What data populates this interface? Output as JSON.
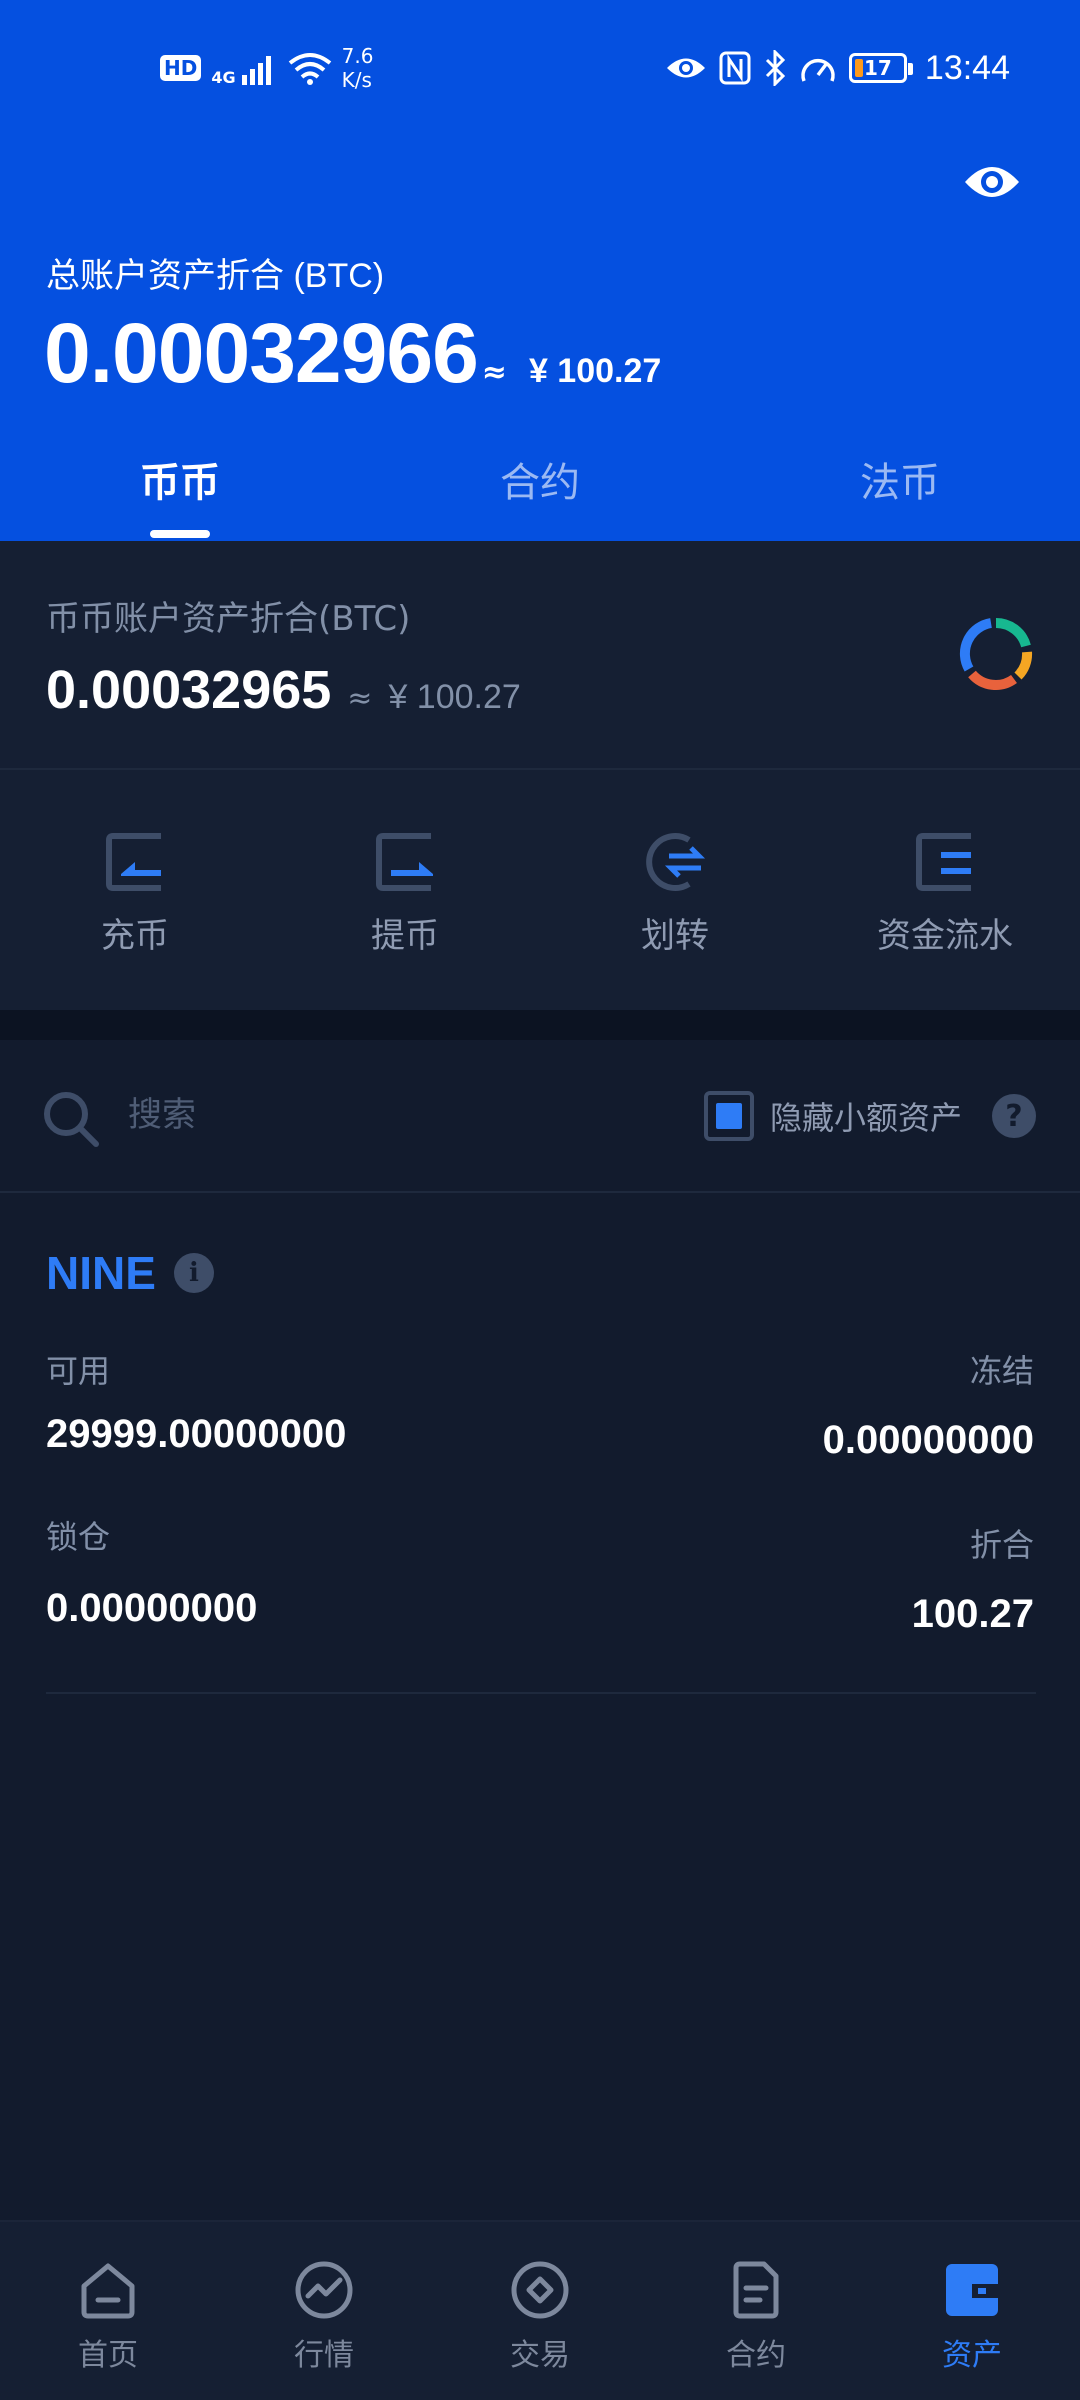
{
  "status_bar": {
    "hd": "HD",
    "network": "4G",
    "speed_value": "7.6",
    "speed_unit": "K/s",
    "battery": "17",
    "time": "13:44"
  },
  "header": {
    "total_label": "总账户资产折合 (BTC)",
    "total_value": "0.00032966",
    "approx_symbol": "≈",
    "total_cny": "¥ 100.27",
    "tabs": [
      {
        "label": "币币",
        "active": true
      },
      {
        "label": "合约",
        "active": false
      },
      {
        "label": "法币",
        "active": false
      }
    ]
  },
  "account": {
    "label": "币币账户资产折合(BTC)",
    "value": "0.00032965",
    "approx_symbol": "≈",
    "cny": "¥ 100.27"
  },
  "actions": [
    {
      "label": "充币",
      "icon": "deposit-icon"
    },
    {
      "label": "提币",
      "icon": "withdraw-icon"
    },
    {
      "label": "划转",
      "icon": "transfer-icon"
    },
    {
      "label": "资金流水",
      "icon": "ledger-icon"
    }
  ],
  "search": {
    "placeholder": "搜索",
    "value": "",
    "hide_small_label": "隐藏小额资产",
    "hide_small_checked": true,
    "help": "?"
  },
  "coin": {
    "name": "NINE",
    "info": "i",
    "available_label": "可用",
    "available_value": "29999.00000000",
    "frozen_label": "冻结",
    "frozen_value": "0.00000000",
    "locked_label": "锁仓",
    "locked_value": "0.00000000",
    "equivalent_label": "折合",
    "equivalent_value": "100.27"
  },
  "bottom_nav": [
    {
      "label": "首页",
      "icon": "home-icon",
      "active": false
    },
    {
      "label": "行情",
      "icon": "market-icon",
      "active": false
    },
    {
      "label": "交易",
      "icon": "trade-icon",
      "active": false
    },
    {
      "label": "合约",
      "icon": "contract-icon",
      "active": false
    },
    {
      "label": "资产",
      "icon": "wallet-icon",
      "active": true
    }
  ],
  "colors": {
    "header_blue": "#0550e0",
    "background": "#121b2d",
    "accent": "#2e7cf6",
    "muted_text": "#8290a8",
    "donut_segments": [
      "#2e7cf6",
      "#17b890",
      "#f5a623",
      "#e8623c"
    ]
  }
}
